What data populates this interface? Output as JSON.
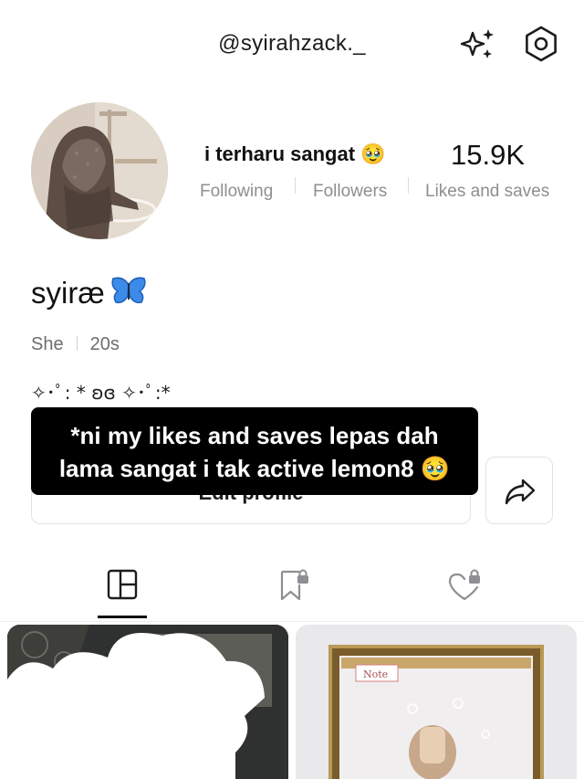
{
  "header": {
    "username": "@syirahzack._"
  },
  "profile": {
    "stats_caption": "i terharu sangat 🥹",
    "likes_saves_value": "15.9K",
    "labels": {
      "following": "Following",
      "followers": "Followers",
      "likes_saves": "Likes and saves"
    },
    "display_name": "syiræ",
    "tags": [
      "She",
      "20s"
    ],
    "bio": "✧･ﾟ: * ʚɞ ✧･ﾟ:*"
  },
  "actions": {
    "edit_profile": "Edit profile"
  },
  "overlay": {
    "line1": "*ni my likes and saves lepas dah",
    "line2": "lama sangat i tak active lemon8 🥹"
  },
  "tabs": [
    {
      "icon": "grid-layout-icon",
      "active": true
    },
    {
      "icon": "bookmark-lock-icon",
      "active": false
    },
    {
      "icon": "heart-lock-icon",
      "active": false
    }
  ],
  "posts": [
    {
      "note_label": ""
    },
    {
      "note_label": "Note"
    }
  ],
  "colors": {
    "text": "#1c1c1e",
    "muted": "#8e8e93",
    "overlay_bg": "#000000",
    "butterfly": "#3d8be8"
  }
}
